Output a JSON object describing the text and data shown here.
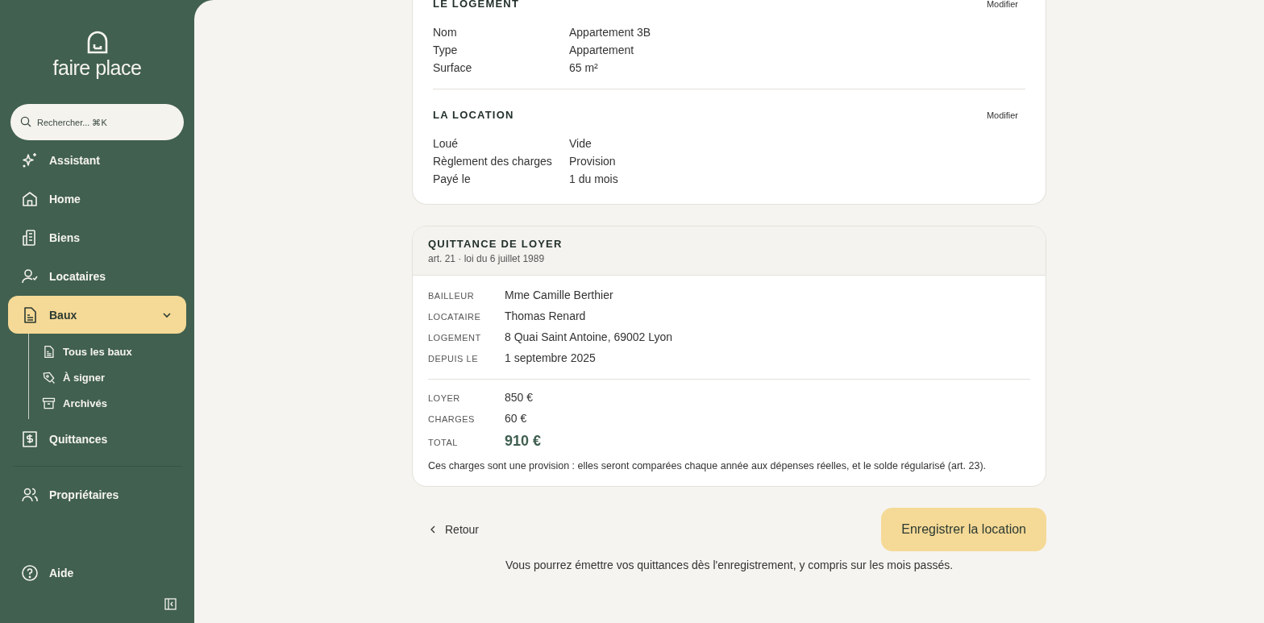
{
  "sidebar": {
    "logo": "faire place",
    "search": {
      "placeholder": "Rechercher... ⌘K"
    },
    "sections": [
      {
        "items": [
          {
            "label": "Assistant",
            "selected": false
          },
          {
            "label": "Home",
            "selected": false
          },
          {
            "label": "Biens",
            "selected": false
          },
          {
            "label": "Locataires",
            "selected": false
          },
          {
            "label": "Baux",
            "selected": true,
            "expanded": true,
            "children": [
              {
                "label": "Tous les baux",
                "selected": false
              },
              {
                "label": "À signer",
                "selected": false
              },
              {
                "label": "Archivés",
                "selected": false
              }
            ]
          },
          {
            "label": "Quittances",
            "selected": false
          }
        ]
      },
      {
        "items": [
          {
            "label": "Propriétaires",
            "selected": false
          }
        ]
      }
    ],
    "footer_items": [
      {
        "label": "Aide",
        "selected": false
      }
    ]
  },
  "details": [
    {
      "title": "LE LOGEMENT",
      "action": "Modifier",
      "rows": [
        {
          "label": "Nom",
          "value": "Appartement 3B"
        },
        {
          "label": "Type",
          "value": "Appartement"
        },
        {
          "label": "Surface",
          "value": "65 m²"
        }
      ]
    },
    {
      "title": "LA LOCATION",
      "action": "Modifier",
      "rows": [
        {
          "label": "Loué",
          "value": "Vide"
        },
        {
          "label": "Règlement des charges",
          "value": "Provision"
        },
        {
          "label": "Payé le",
          "value": "1 du mois"
        }
      ]
    }
  ],
  "receipt": {
    "title": "QUITTANCE DE LOYER",
    "subtitle": "art. 21 · loi du 6 juillet 1989",
    "parties": [
      {
        "label": "BAILLEUR",
        "value": "Mme Camille Berthier"
      },
      {
        "label": "LOCATAIRE",
        "value": "Thomas Renard"
      },
      {
        "label": "LOGEMENT",
        "value": "8 Quai Saint Antoine, 69002 Lyon"
      },
      {
        "label": "DEPUIS LE",
        "value": "1 septembre 2025"
      }
    ],
    "amounts": [
      {
        "label": "LOYER",
        "value": "850 €",
        "kind": "line"
      },
      {
        "label": "CHARGES",
        "value": "60 €",
        "kind": "line"
      },
      {
        "label": "TOTAL",
        "value": "910 €",
        "kind": "total"
      }
    ],
    "note": "Ces charges sont une provision : elles seront comparées chaque année aux dépenses réelles, et le solde régularisé (art. 23)."
  },
  "footer": {
    "back": "Retour",
    "submit": "Enregistrer la location",
    "note": "Vous pourrez émettre vos quittances dès l'enregistrement, y compris sur les mois passés."
  }
}
